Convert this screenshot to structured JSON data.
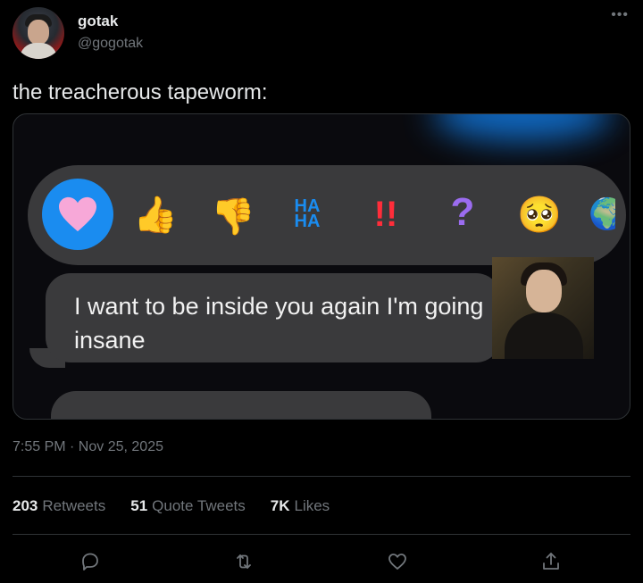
{
  "author": {
    "name": "gotak",
    "handle": "@gogotak"
  },
  "tweet": {
    "text": "the treacherous tapeworm:"
  },
  "media": {
    "reactions": [
      "heart-icon",
      "thumbs-up-icon",
      "thumbs-down-icon",
      "haha-icon",
      "exclamation-icon",
      "question-icon",
      "pleading-face-icon"
    ],
    "haha_label": "HA\nHA",
    "bang_label": "!!",
    "question_label": "?",
    "message": "I want to be inside you again I'm going insane"
  },
  "timestamp": "7:55 PM · Nov 25, 2025",
  "stats": {
    "retweets_count": "203",
    "retweets_label": "Retweets",
    "quotes_count": "51",
    "quotes_label": "Quote Tweets",
    "likes_count": "7K",
    "likes_label": "Likes"
  },
  "colors": {
    "background": "#000000",
    "text": "#e7e9ea",
    "muted": "#71767b",
    "imessage_blue": "#1a8cf0",
    "bubble": "#3a3a3c"
  }
}
